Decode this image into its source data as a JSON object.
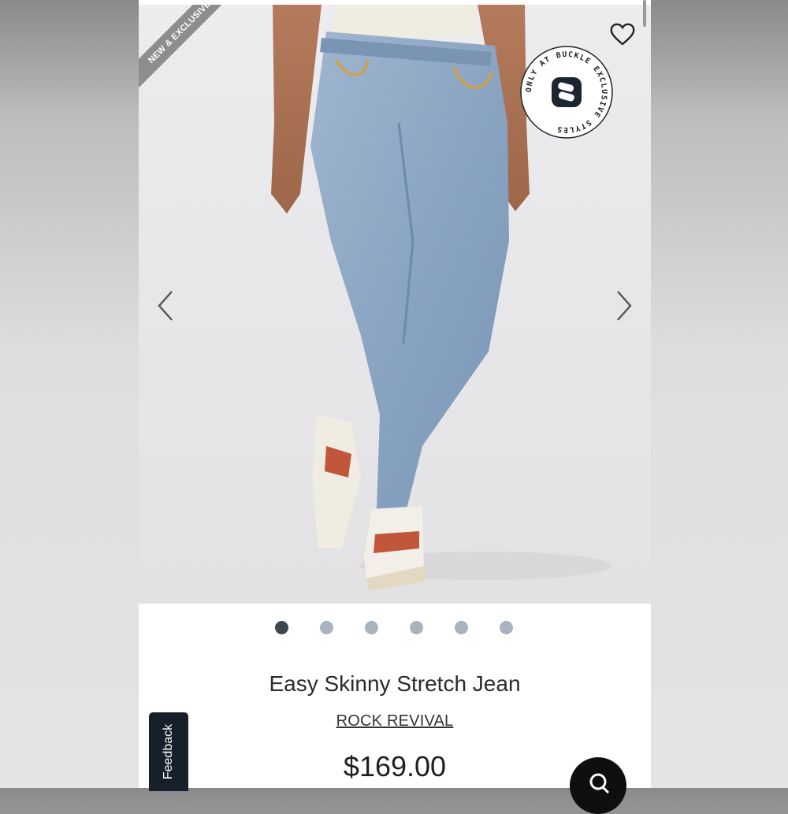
{
  "product": {
    "ribbon_label": "NEW & EXCLUSIVE",
    "badge_text": "ONLY AT BUCKLE EXCLUSIVE STYLES",
    "title": "Easy Skinny Stretch Jean",
    "brand": "ROCK REVIVAL",
    "price": "$169.00"
  },
  "gallery": {
    "image_count": 6,
    "active_index": 0
  },
  "feedback": {
    "label": "Feedback"
  },
  "icons": {
    "wishlist": "heart-icon",
    "prev": "chevron-left-icon",
    "next": "chevron-right-icon",
    "search": "search-icon"
  },
  "colors": {
    "dot_active": "#3e4650",
    "dot_inactive": "#a9b3bd",
    "feedback_bg": "#17202a"
  }
}
